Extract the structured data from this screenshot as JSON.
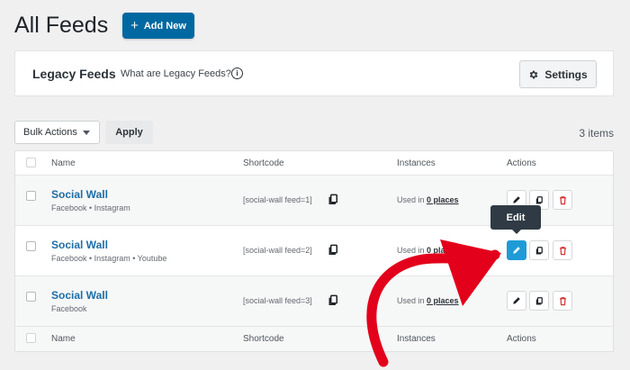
{
  "header": {
    "title": "All Feeds",
    "add_new_label": "Add New"
  },
  "legacy": {
    "title": "Legacy Feeds",
    "question": "What are Legacy Feeds?",
    "info_glyph": "i",
    "settings_label": "Settings"
  },
  "toolbar": {
    "bulk_actions": "Bulk Actions",
    "apply_label": "Apply",
    "item_count": "3 items"
  },
  "table": {
    "columns": [
      "Name",
      "Shortcode",
      "Instances",
      "Actions"
    ],
    "rows": [
      {
        "name": "Social Wall",
        "sources": "Facebook • Instagram",
        "shortcode": "[social-wall feed=1]",
        "used_prefix": "Used in",
        "used_link": "0 places"
      },
      {
        "name": "Social Wall",
        "sources": "Facebook • Instagram • Youtube",
        "shortcode": "[social-wall feed=2]",
        "used_prefix": "Used in",
        "used_link": "0 places"
      },
      {
        "name": "Social Wall",
        "sources": "Facebook",
        "shortcode": "[social-wall feed=3]",
        "used_prefix": "Used in",
        "used_link": "0 places"
      }
    ]
  },
  "tooltip": {
    "label": "Edit"
  },
  "colors": {
    "primary": "#0068a0",
    "edit_active": "#1e9bd7",
    "delete": "#d63638",
    "annotation_arrow": "#e3001b",
    "link": "#1d6ea6"
  },
  "icons": [
    "plus-icon",
    "gear-icon",
    "info-icon",
    "pencil-icon",
    "copy-icon",
    "trash-icon",
    "caret-down-icon"
  ]
}
